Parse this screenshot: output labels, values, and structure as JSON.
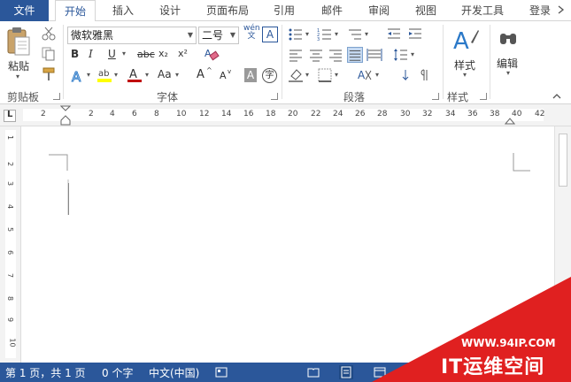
{
  "tabs": {
    "file": "文件",
    "items": [
      "开始",
      "插入",
      "设计",
      "页面布局",
      "引用",
      "邮件",
      "审阅",
      "视图",
      "开发工具"
    ],
    "active": "开始",
    "login": "登录"
  },
  "ribbon": {
    "clipboard": {
      "paste_label": "粘贴",
      "group_label": "剪贴板"
    },
    "font": {
      "font_name": "微软雅黑",
      "font_size": "二号",
      "wen_label": "wén\n文",
      "group_label": "字体",
      "bold": "B",
      "italic": "I",
      "underline": "U",
      "strike": "abc",
      "subscript": "x₂",
      "superscript": "x²",
      "grow": "A",
      "shrink": "A",
      "case": "Aa",
      "char_border": "A",
      "phonetic": "字"
    },
    "paragraph": {
      "group_label": "段落"
    },
    "styles": {
      "styles_label": "样式",
      "group_label": "样式"
    },
    "editing": {
      "editing_label": "编辑"
    }
  },
  "ruler": {
    "ticks": [
      "2",
      "2",
      "4",
      "6",
      "8",
      "10",
      "12",
      "14",
      "16",
      "18",
      "20",
      "22",
      "24",
      "26",
      "28",
      "30",
      "32",
      "34",
      "36",
      "38",
      "40",
      "42"
    ],
    "vticks": [
      "2",
      "1",
      "1",
      "2",
      "1",
      "2",
      "3",
      "4",
      "5",
      "6",
      "7",
      "8",
      "9",
      "10"
    ],
    "tab_stop_symbol": "L"
  },
  "status": {
    "page_info": "第 1 页，共 1 页",
    "word_count": "0 个字",
    "language": "中文(中国)"
  },
  "watermark": {
    "url": "WWW.94IP.COM",
    "brand": "IT运维空间"
  },
  "colors": {
    "accent": "#2b579a",
    "highlight_yellow": "#ffff00",
    "font_red": "#c00000",
    "watermark_red": "#e02020"
  }
}
